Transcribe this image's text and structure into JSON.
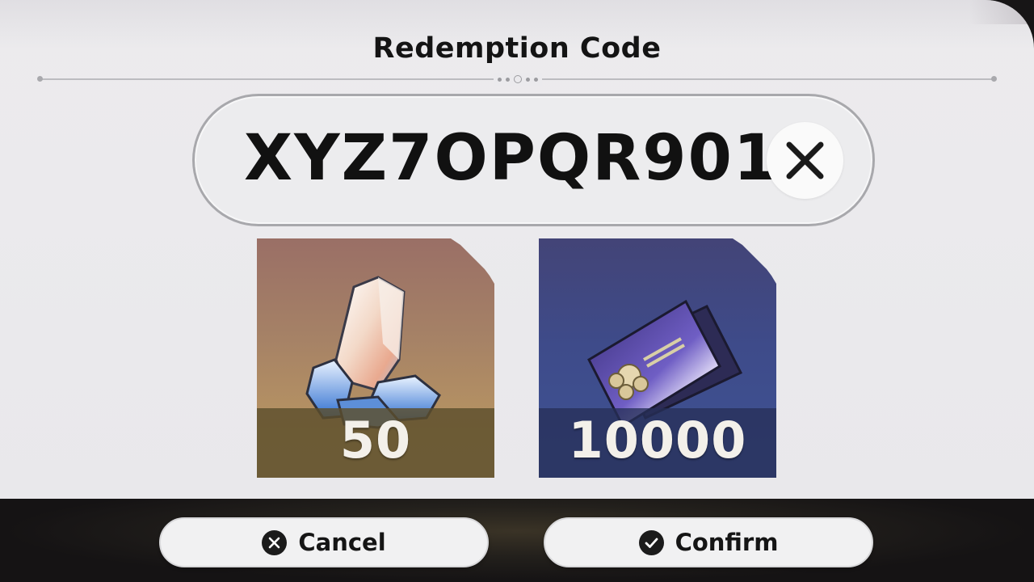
{
  "dialog": {
    "title": "Redemption Code",
    "code_input": {
      "value": "XYZ7OPQR9012"
    },
    "clear_icon": "close-icon"
  },
  "rewards": [
    {
      "name": "crystal",
      "icon": "crystal-icon",
      "count": "50"
    },
    {
      "name": "ticket",
      "icon": "ticket-icon",
      "count": "10000"
    }
  ],
  "buttons": {
    "cancel": {
      "label": "Cancel",
      "icon": "cancel-circle-icon"
    },
    "confirm": {
      "label": "Confirm",
      "icon": "check-circle-icon"
    }
  },
  "colors": {
    "panel_bg": "#ebeaed",
    "reward1_bg": "#a58166",
    "reward2_bg": "#3e4b8a",
    "button_bg": "#f1f1f2",
    "text_dark": "#141414"
  }
}
